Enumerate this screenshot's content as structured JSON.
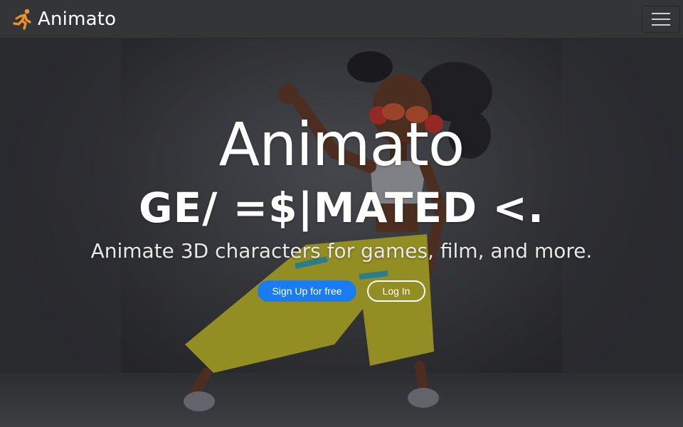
{
  "navbar": {
    "brand_name": "Animato",
    "brand_icon": "running-figure-icon",
    "brand_color": "#f2902a",
    "menu_icon": "hamburger-menu-icon"
  },
  "hero": {
    "title": "Animato",
    "glitch_text": "GE/ =$|MATED <.",
    "subtitle": "Animate 3D characters for games, film, and more.",
    "background_image": "3D animated dancing character",
    "buttons": {
      "signup_label": "Sign Up for free",
      "login_label": "Log In"
    }
  },
  "colors": {
    "navbar_bg": "#343536",
    "primary": "#1d7bf0",
    "text": "#ffffff"
  }
}
